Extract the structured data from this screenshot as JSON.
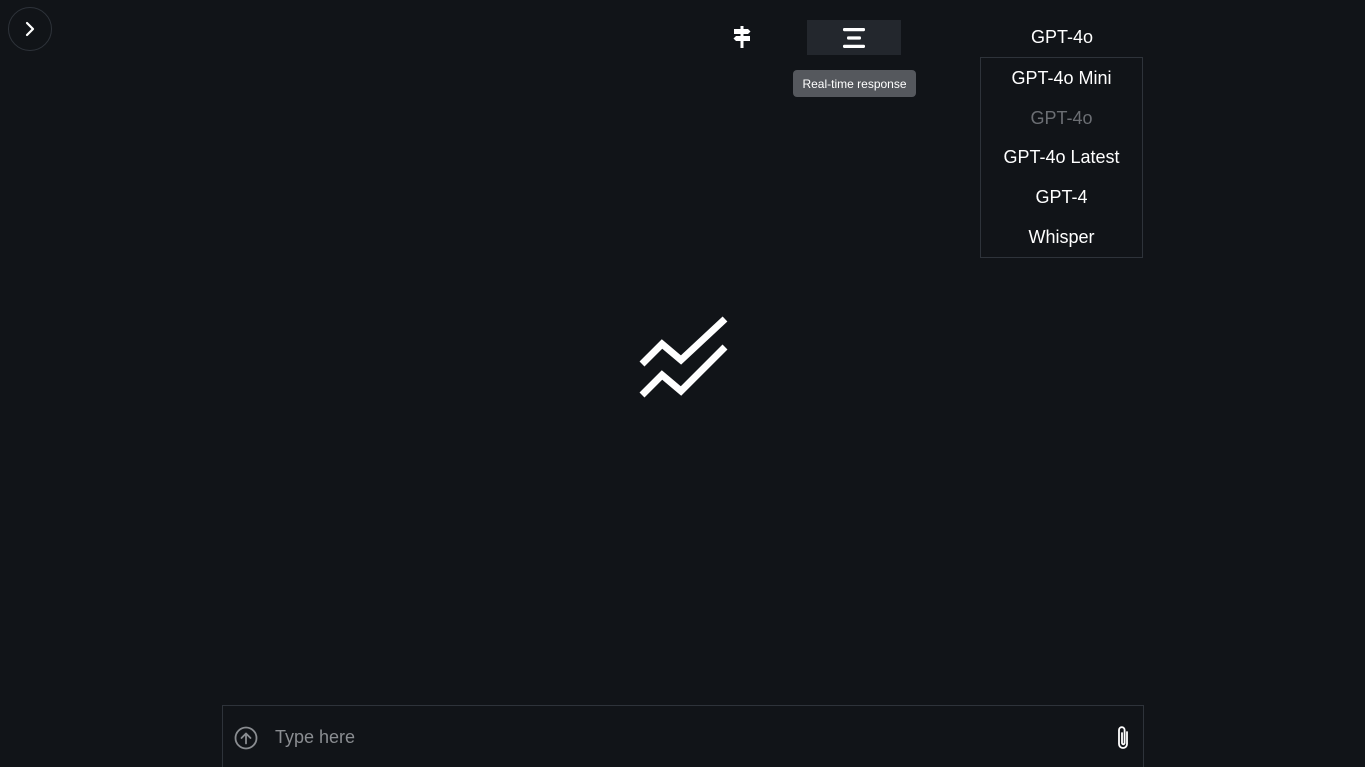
{
  "toolbar": {
    "sidebar_toggle_icon": "chevron-right-icon",
    "signpost_icon": "signpost-icon",
    "realtime_icon": "align-center-icon",
    "realtime_tooltip": "Real-time response"
  },
  "model_selector": {
    "current": "GPT-4o",
    "options": [
      {
        "label": "GPT-4o Mini",
        "selected": false
      },
      {
        "label": "GPT-4o",
        "selected": true
      },
      {
        "label": "GPT-4o Latest",
        "selected": false
      },
      {
        "label": "GPT-4",
        "selected": false
      },
      {
        "label": "Whisper",
        "selected": false
      }
    ]
  },
  "logo_icon": "double-zigzag-logo",
  "composer": {
    "placeholder": "Type here",
    "value": "",
    "upload_icon": "arrow-up-circle-icon",
    "attach_icon": "paperclip-icon"
  },
  "colors": {
    "background": "#111418",
    "panel_border": "#2e333a",
    "button_active_bg": "#23272d",
    "tooltip_bg": "#55585d",
    "text": "#ffffff",
    "muted_text": "#6b6e73",
    "placeholder": "#8a8d91"
  }
}
